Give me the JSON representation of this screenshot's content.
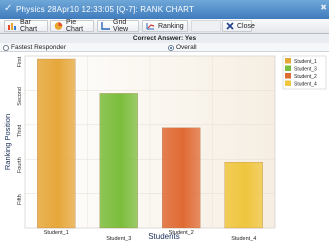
{
  "window": {
    "title": "Physics 28Apr10 12:33:05 [Q-7]: RANK CHART",
    "close_label": "✖"
  },
  "toolbar": {
    "bar_chart": "Bar Chart",
    "pie_chart": "Pie Chart",
    "grid_view": "Grid View",
    "ranking": "Ranking",
    "close": "Close"
  },
  "answer": {
    "text": "Correct Answer: Yes"
  },
  "options": {
    "fastest": "Fastest Responder",
    "overall": "Overall",
    "selected": "overall"
  },
  "colors": {
    "titlebar": "#3f7bbd",
    "accent_close": "#1f3f8f"
  },
  "chart_data": {
    "type": "bar",
    "xlabel": "Students",
    "ylabel": "Ranking Position",
    "y_ticks": [
      "First",
      "Second",
      "Third",
      "Fourth",
      "Fifth"
    ],
    "categories": [
      "Student_1",
      "Student_3",
      "Student_2",
      "Student_4"
    ],
    "values": [
      1,
      2,
      3,
      4
    ],
    "colors": [
      "#e6a73a",
      "#7bbd3c",
      "#e06a34",
      "#f0c63e"
    ],
    "legend": [
      "Student_1",
      "Student_3",
      "Student_2",
      "Student_4"
    ],
    "legend_position": "top-right",
    "grid": true
  }
}
